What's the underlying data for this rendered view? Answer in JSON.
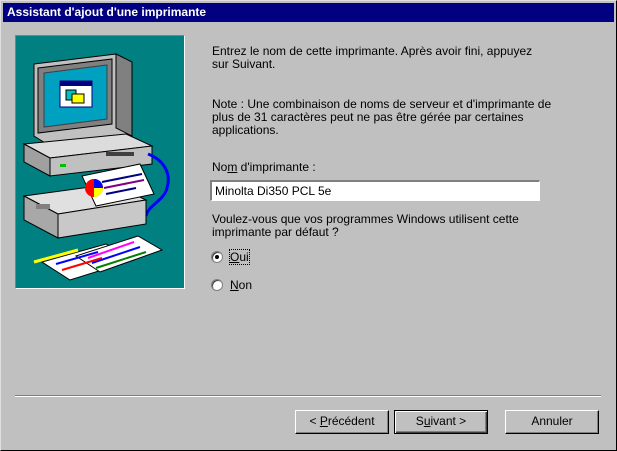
{
  "window": {
    "title": "Assistant d'ajout d'une imprimante"
  },
  "content": {
    "intro": "Entrez le nom de cette imprimante. Après avoir fini, appuyez sur Suivant.",
    "note": "Note : Une combinaison de noms de serveur et d'imprimante de plus de 31 caractères peut ne pas être gérée par certaines applications.",
    "name_label_pre": "No",
    "name_label_key": "m",
    "name_label_post": " d'imprimante :",
    "printer_name": "Minolta Di350 PCL 5e",
    "question": "Voulez-vous que vos programmes Windows utilisent cette imprimante par défaut ?",
    "options": [
      {
        "key": "O",
        "rest": "ui",
        "selected": true
      },
      {
        "key": "N",
        "rest": "on",
        "selected": false
      }
    ]
  },
  "buttons": {
    "back_pre": "< ",
    "back_key": "P",
    "back_post": "récédent",
    "next_pre": "S",
    "next_key": "u",
    "next_post": "ivant >",
    "cancel": "Annuler"
  },
  "colors": {
    "title_bar": "#000080",
    "dialog_face": "#c0c0c0",
    "illustration_bg": "#008080"
  },
  "icons": {
    "illustration": "computer-printer-illustration"
  }
}
